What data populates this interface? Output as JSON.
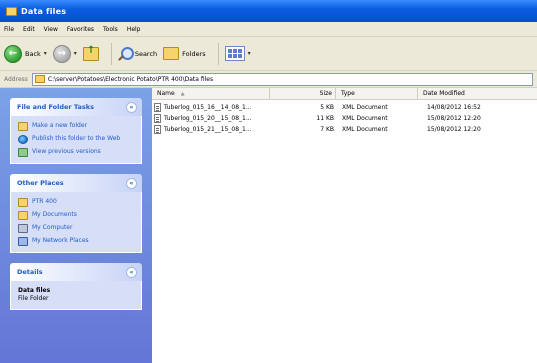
{
  "window": {
    "title": "Data files"
  },
  "menu": [
    "File",
    "Edit",
    "View",
    "Favorites",
    "Tools",
    "Help"
  ],
  "toolbar": {
    "back_label": "Back",
    "search_label": "Search",
    "folders_label": "Folders"
  },
  "address": {
    "label": "Address",
    "path": "C:\\server\\Potatoes\\Electronic Potato\\PTR 400\\Data files"
  },
  "sidebar": {
    "file_tasks": {
      "title": "File and Folder Tasks",
      "items": [
        {
          "label": "Make a new folder",
          "icon": "new-folder-icon"
        },
        {
          "label": "Publish this folder to the Web",
          "icon": "publish-web-icon"
        },
        {
          "label": "View previous versions",
          "icon": "previous-versions-icon"
        }
      ]
    },
    "other_places": {
      "title": "Other Places",
      "items": [
        {
          "label": "PTR 400",
          "icon": "folder-icon"
        },
        {
          "label": "My Documents",
          "icon": "my-documents-icon"
        },
        {
          "label": "My Computer",
          "icon": "my-computer-icon"
        },
        {
          "label": "My Network Places",
          "icon": "my-network-places-icon"
        }
      ]
    },
    "details": {
      "title": "Details",
      "name": "Data files",
      "type": "File Folder"
    }
  },
  "filelist": {
    "columns": {
      "name": "Name",
      "size": "Size",
      "type": "Type",
      "date": "Date Modified"
    },
    "rows": [
      {
        "name": "Tuberlog_015_16__14_08_1...",
        "size": "5 KB",
        "type": "XML Document",
        "date": "14/08/2012 16:52"
      },
      {
        "name": "Tuberlog_015_20__15_08_1...",
        "size": "11 KB",
        "type": "XML Document",
        "date": "15/08/2012 12:20"
      },
      {
        "name": "Tuberlog_015_21__15_08_1...",
        "size": "7 KB",
        "type": "XML Document",
        "date": "15/08/2012 12:20"
      }
    ]
  }
}
